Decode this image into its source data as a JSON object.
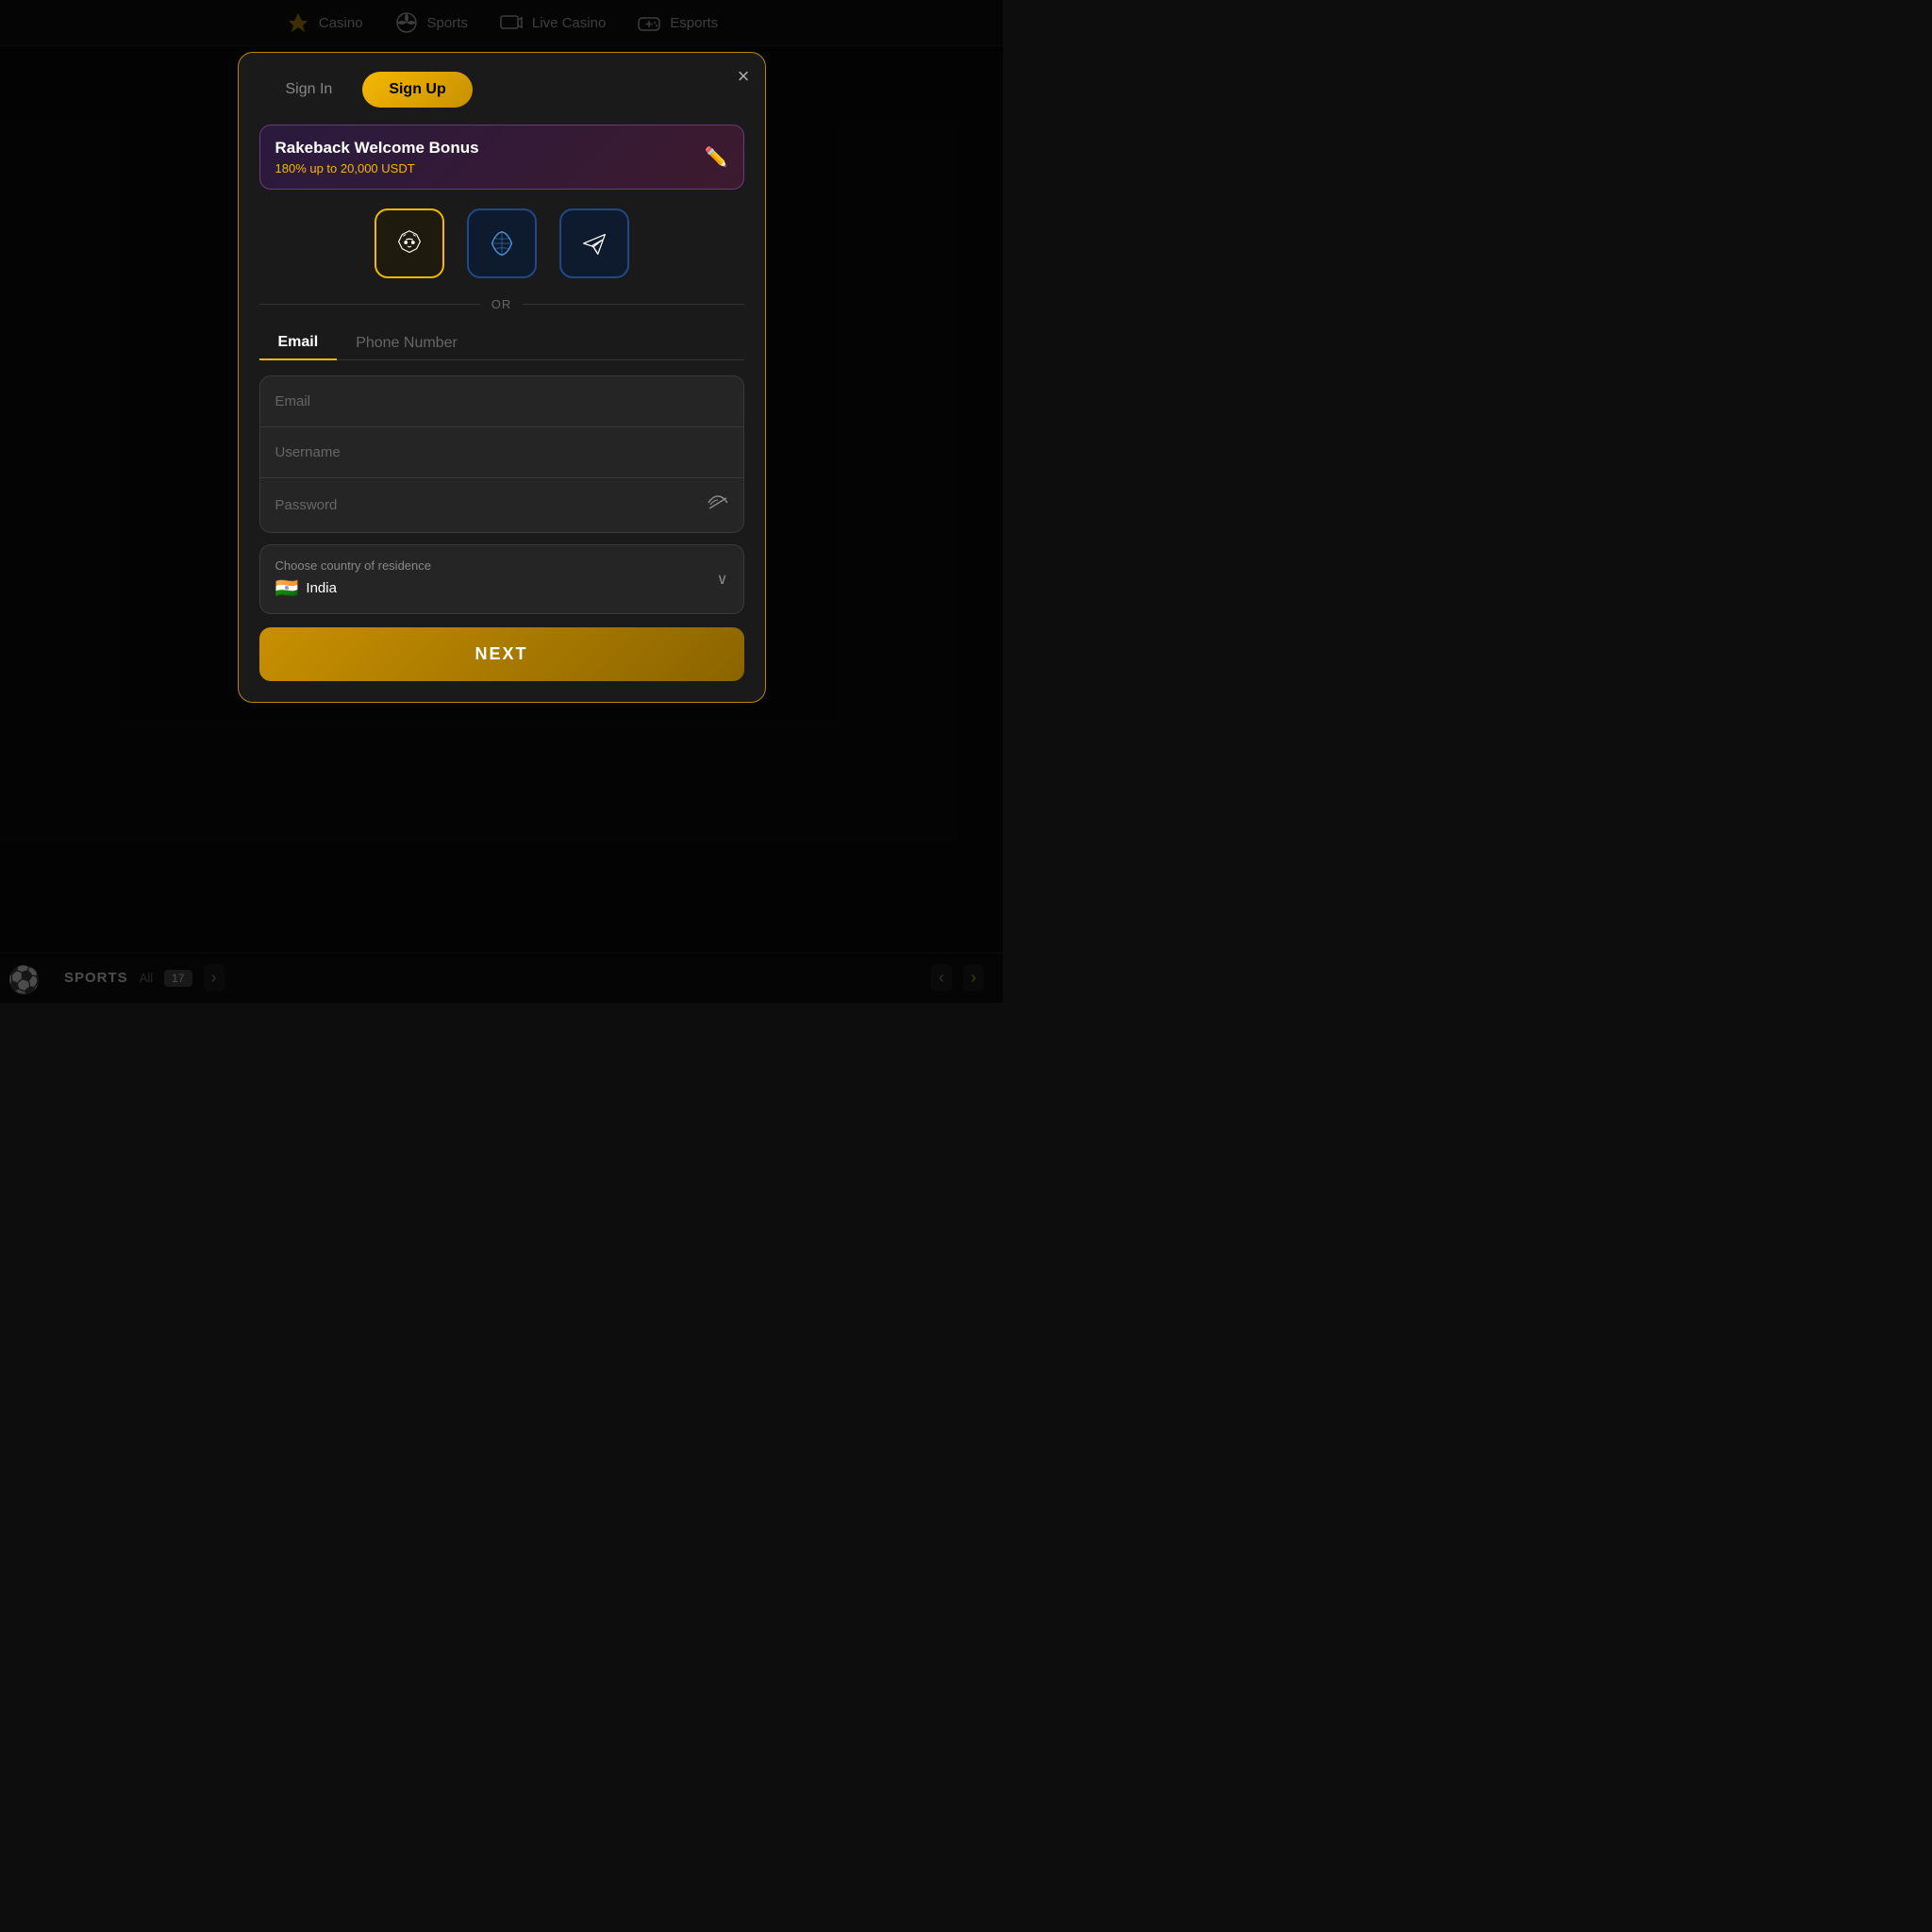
{
  "nav": {
    "items": [
      {
        "id": "casino",
        "label": "Casino"
      },
      {
        "id": "sports",
        "label": "Sports"
      },
      {
        "id": "live-casino",
        "label": "Live Casino"
      },
      {
        "id": "esports",
        "label": "Esports"
      }
    ]
  },
  "modal": {
    "close_label": "×",
    "auth_tabs": {
      "signin": "Sign In",
      "signup": "Sign Up"
    },
    "bonus": {
      "title": "Rakeback Welcome Bonus",
      "subtitle": "180% up to 20,000 USDT"
    },
    "social_buttons": [
      {
        "id": "fox",
        "label": "Fox/MetaMask"
      },
      {
        "id": "wallet",
        "label": "WalletConnect"
      },
      {
        "id": "telegram",
        "label": "Telegram"
      }
    ],
    "or_text": "OR",
    "input_tabs": {
      "email": "Email",
      "phone": "Phone Number"
    },
    "form": {
      "email_placeholder": "Email",
      "username_placeholder": "Username",
      "password_placeholder": "Password"
    },
    "country": {
      "label": "Choose country of residence",
      "value": "India",
      "flag": "🇮🇳"
    },
    "next_button": "NEXT"
  },
  "sports_bar": {
    "label": "SPORTS",
    "count_all": "All",
    "count": "17"
  }
}
